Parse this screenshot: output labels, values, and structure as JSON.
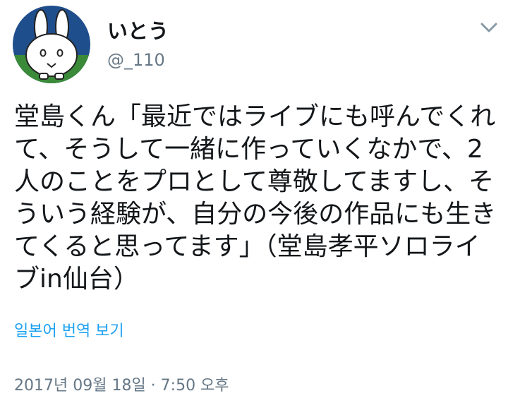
{
  "tweet": {
    "avatar_icon": "miffy-avatar-icon",
    "display_name": "いとう",
    "handle": "@_110",
    "menu_icon": "chevron-down-icon",
    "body_text": "堂島くん「最近ではライブにも呼んでくれて、そうして一緒に作っていくなかで、2人のことをプロとして尊敬してますし、そういう経験が、自分の今後の作品にも生きてくると思ってます」（堂島孝平ソロライブin仙台）",
    "translate_label": "일본어 번역 보기",
    "timestamp": "2017년 09월 18일 · 7:50 오후"
  },
  "colors": {
    "text": "#14171a",
    "secondary": "#657786",
    "link": "#1da1f2",
    "avatar_sky": "#1f4e8c",
    "avatar_ground": "#3a8a3a"
  }
}
